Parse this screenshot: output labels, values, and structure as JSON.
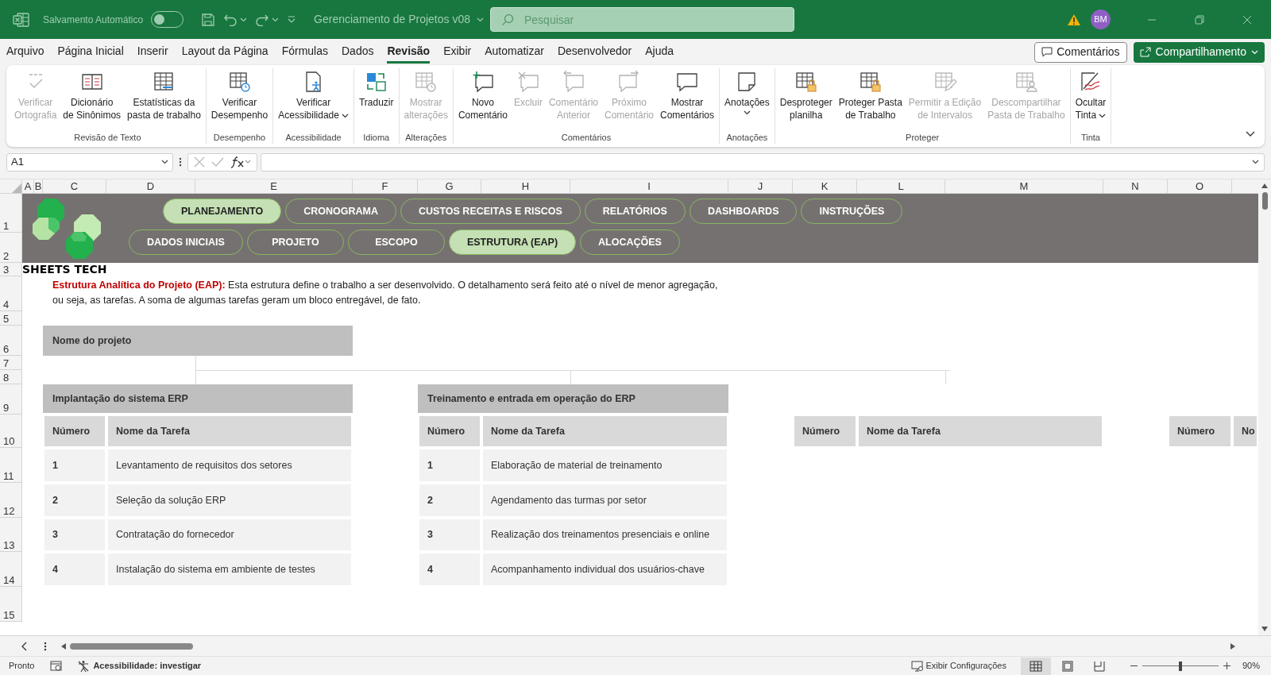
{
  "title_bar": {
    "autosave_label": "Salvamento Automático",
    "autosave_on": false,
    "document_title": "Gerenciamento de Projetos v08",
    "search_placeholder": "Pesquisar",
    "user_initials": "BM"
  },
  "menu_tabs": [
    {
      "label": "Arquivo",
      "selected": false
    },
    {
      "label": "Página Inicial",
      "selected": false
    },
    {
      "label": "Inserir",
      "selected": false
    },
    {
      "label": "Layout da Página",
      "selected": false
    },
    {
      "label": "Fórmulas",
      "selected": false
    },
    {
      "label": "Dados",
      "selected": false
    },
    {
      "label": "Revisão",
      "selected": true
    },
    {
      "label": "Exibir",
      "selected": false
    },
    {
      "label": "Automatizar",
      "selected": false
    },
    {
      "label": "Desenvolvedor",
      "selected": false
    },
    {
      "label": "Ajuda",
      "selected": false
    }
  ],
  "menu_buttons": {
    "comments": "Comentários",
    "share": "Compartilhamento"
  },
  "ribbon_groups": [
    {
      "label": "Revisão de Texto",
      "buttons": [
        {
          "label": "Verificar\nOrtografia",
          "disabled": true
        },
        {
          "label": "Dicionário\nde Sinônimos",
          "disabled": false
        },
        {
          "label": "Estatísticas da\npasta de trabalho",
          "disabled": false
        }
      ]
    },
    {
      "label": "Desempenho",
      "buttons": [
        {
          "label": "Verificar\nDesempenho",
          "disabled": false
        }
      ]
    },
    {
      "label": "Acessibilidade",
      "buttons": [
        {
          "label": "Verificar\nAcessibilidade",
          "disabled": false,
          "dropdown": true
        }
      ]
    },
    {
      "label": "Idioma",
      "buttons": [
        {
          "label": "Traduzir",
          "disabled": false
        }
      ]
    },
    {
      "label": "Alterações",
      "buttons": [
        {
          "label": "Mostrar\nalterações",
          "disabled": true
        }
      ]
    },
    {
      "label": "Comentários",
      "buttons": [
        {
          "label": "Novo\nComentário",
          "disabled": false
        },
        {
          "label": "Excluir",
          "disabled": true
        },
        {
          "label": "Comentário\nAnterior",
          "disabled": true
        },
        {
          "label": "Próximo\nComentário",
          "disabled": true
        },
        {
          "label": "Mostrar\nComentários",
          "disabled": false
        }
      ]
    },
    {
      "label": "Anotações",
      "buttons": [
        {
          "label": "Anotações",
          "disabled": false,
          "dropdown": true
        }
      ]
    },
    {
      "label": "Proteger",
      "buttons": [
        {
          "label": "Desproteger\nplanilha",
          "disabled": false
        },
        {
          "label": "Proteger Pasta\nde Trabalho",
          "disabled": false
        },
        {
          "label": "Permitir a Edição\nde Intervalos",
          "disabled": true
        },
        {
          "label": "Descompartilhar\nPasta de Trabalho",
          "disabled": true
        }
      ]
    },
    {
      "label": "Tinta",
      "buttons": [
        {
          "label": "Ocultar\nTinta",
          "disabled": false,
          "dropdown": true
        }
      ]
    }
  ],
  "formula_bar": {
    "name_box": "A1"
  },
  "column_headers": [
    "A",
    "B",
    "C",
    "D",
    "E",
    "F",
    "G",
    "H",
    "I",
    "J",
    "K",
    "L",
    "M",
    "N",
    "O"
  ],
  "row_headers": [
    "1",
    "2",
    "3",
    "4",
    "5",
    "6",
    "7",
    "8",
    "9",
    "10",
    "11",
    "12",
    "13",
    "14",
    "15"
  ],
  "nav_rows": [
    [
      {
        "label": "PLANEJAMENTO",
        "selected": true
      },
      {
        "label": "CRONOGRAMA",
        "selected": false
      },
      {
        "label": "CUSTOS RECEITAS E RISCOS",
        "selected": false
      },
      {
        "label": "RELATÓRIOS",
        "selected": false
      },
      {
        "label": "DASHBOARDS",
        "selected": false
      },
      {
        "label": "INSTRUÇÕES",
        "selected": false
      }
    ],
    [
      {
        "label": "DADOS INICIAIS",
        "selected": false
      },
      {
        "label": "PROJETO",
        "selected": false
      },
      {
        "label": "ESCOPO",
        "selected": false
      },
      {
        "label": "ESTRUTURA (EAP)",
        "selected": true
      },
      {
        "label": "ALOCAÇÕES",
        "selected": false
      }
    ]
  ],
  "logo_text": "SHEETS TECH",
  "intro": {
    "lead": "Estrutura Analítica do Projeto (EAP):",
    "text": "Esta estrutura define o trabalho a ser desenvolvido. O detalhamento será feito até o nível de menor agregação, ou seja, as tarefas. A soma de algumas tarefas geram um bloco entregável, de fato."
  },
  "project_name_label": "Nome do projeto",
  "blocks": [
    {
      "title": "Implantação do sistema ERP",
      "columns": [
        "Número",
        "Nome da Tarefa"
      ],
      "tasks": [
        {
          "number": "1",
          "name": "Levantamento de requisitos dos setores"
        },
        {
          "number": "2",
          "name": "Seleção da solução ERP"
        },
        {
          "number": "3",
          "name": "Contratação do fornecedor"
        },
        {
          "number": "4",
          "name": "Instalação do sistema em ambiente de testes"
        }
      ]
    },
    {
      "title": "Treinamento e entrada em operação do ERP",
      "columns": [
        "Número",
        "Nome da Tarefa"
      ],
      "tasks": [
        {
          "number": "1",
          "name": "Elaboração de material de treinamento"
        },
        {
          "number": "2",
          "name": "Agendamento das turmas por setor"
        },
        {
          "number": "3",
          "name": "Realização dos treinamentos presenciais e online"
        },
        {
          "number": "4",
          "name": "Acompanhamento individual dos usuários-chave"
        }
      ]
    },
    {
      "columns": [
        "Número",
        "Nome da Tarefa"
      ]
    },
    {
      "columns": [
        "Número",
        "No"
      ]
    }
  ],
  "status_bar": {
    "ready": "Pronto",
    "accessibility": "Acessibilidade: investigar",
    "display_settings": "Exibir Configurações",
    "views": [
      {
        "selected": true
      },
      {
        "selected": false
      },
      {
        "selected": false
      }
    ],
    "zoom": {
      "level": 0.5,
      "reading": "90%"
    }
  }
}
